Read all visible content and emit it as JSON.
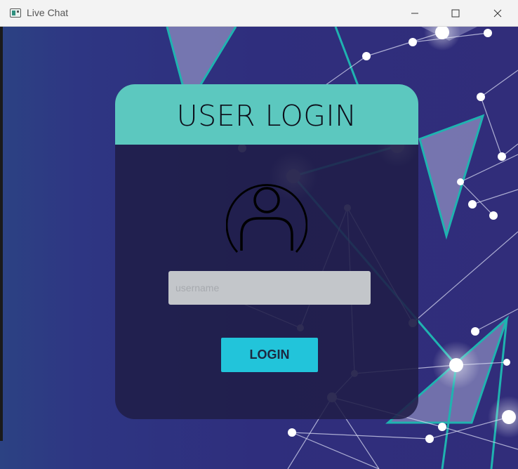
{
  "window": {
    "title": "Live Chat",
    "icon": "app-window-icon",
    "controls": {
      "minimize_icon": "minimize-icon",
      "maximize_icon": "maximize-icon",
      "close_icon": "close-icon"
    }
  },
  "login": {
    "heading": "USER LOGIN",
    "avatar_icon": "user-avatar-icon",
    "username_placeholder": "username",
    "username_value": "",
    "login_button_label": "LOGIN"
  },
  "colors": {
    "header_accent": "#5cc8bf",
    "button_accent": "#22c4da",
    "background": "#2d2f7a",
    "network_lines": "#1fb3b0"
  }
}
